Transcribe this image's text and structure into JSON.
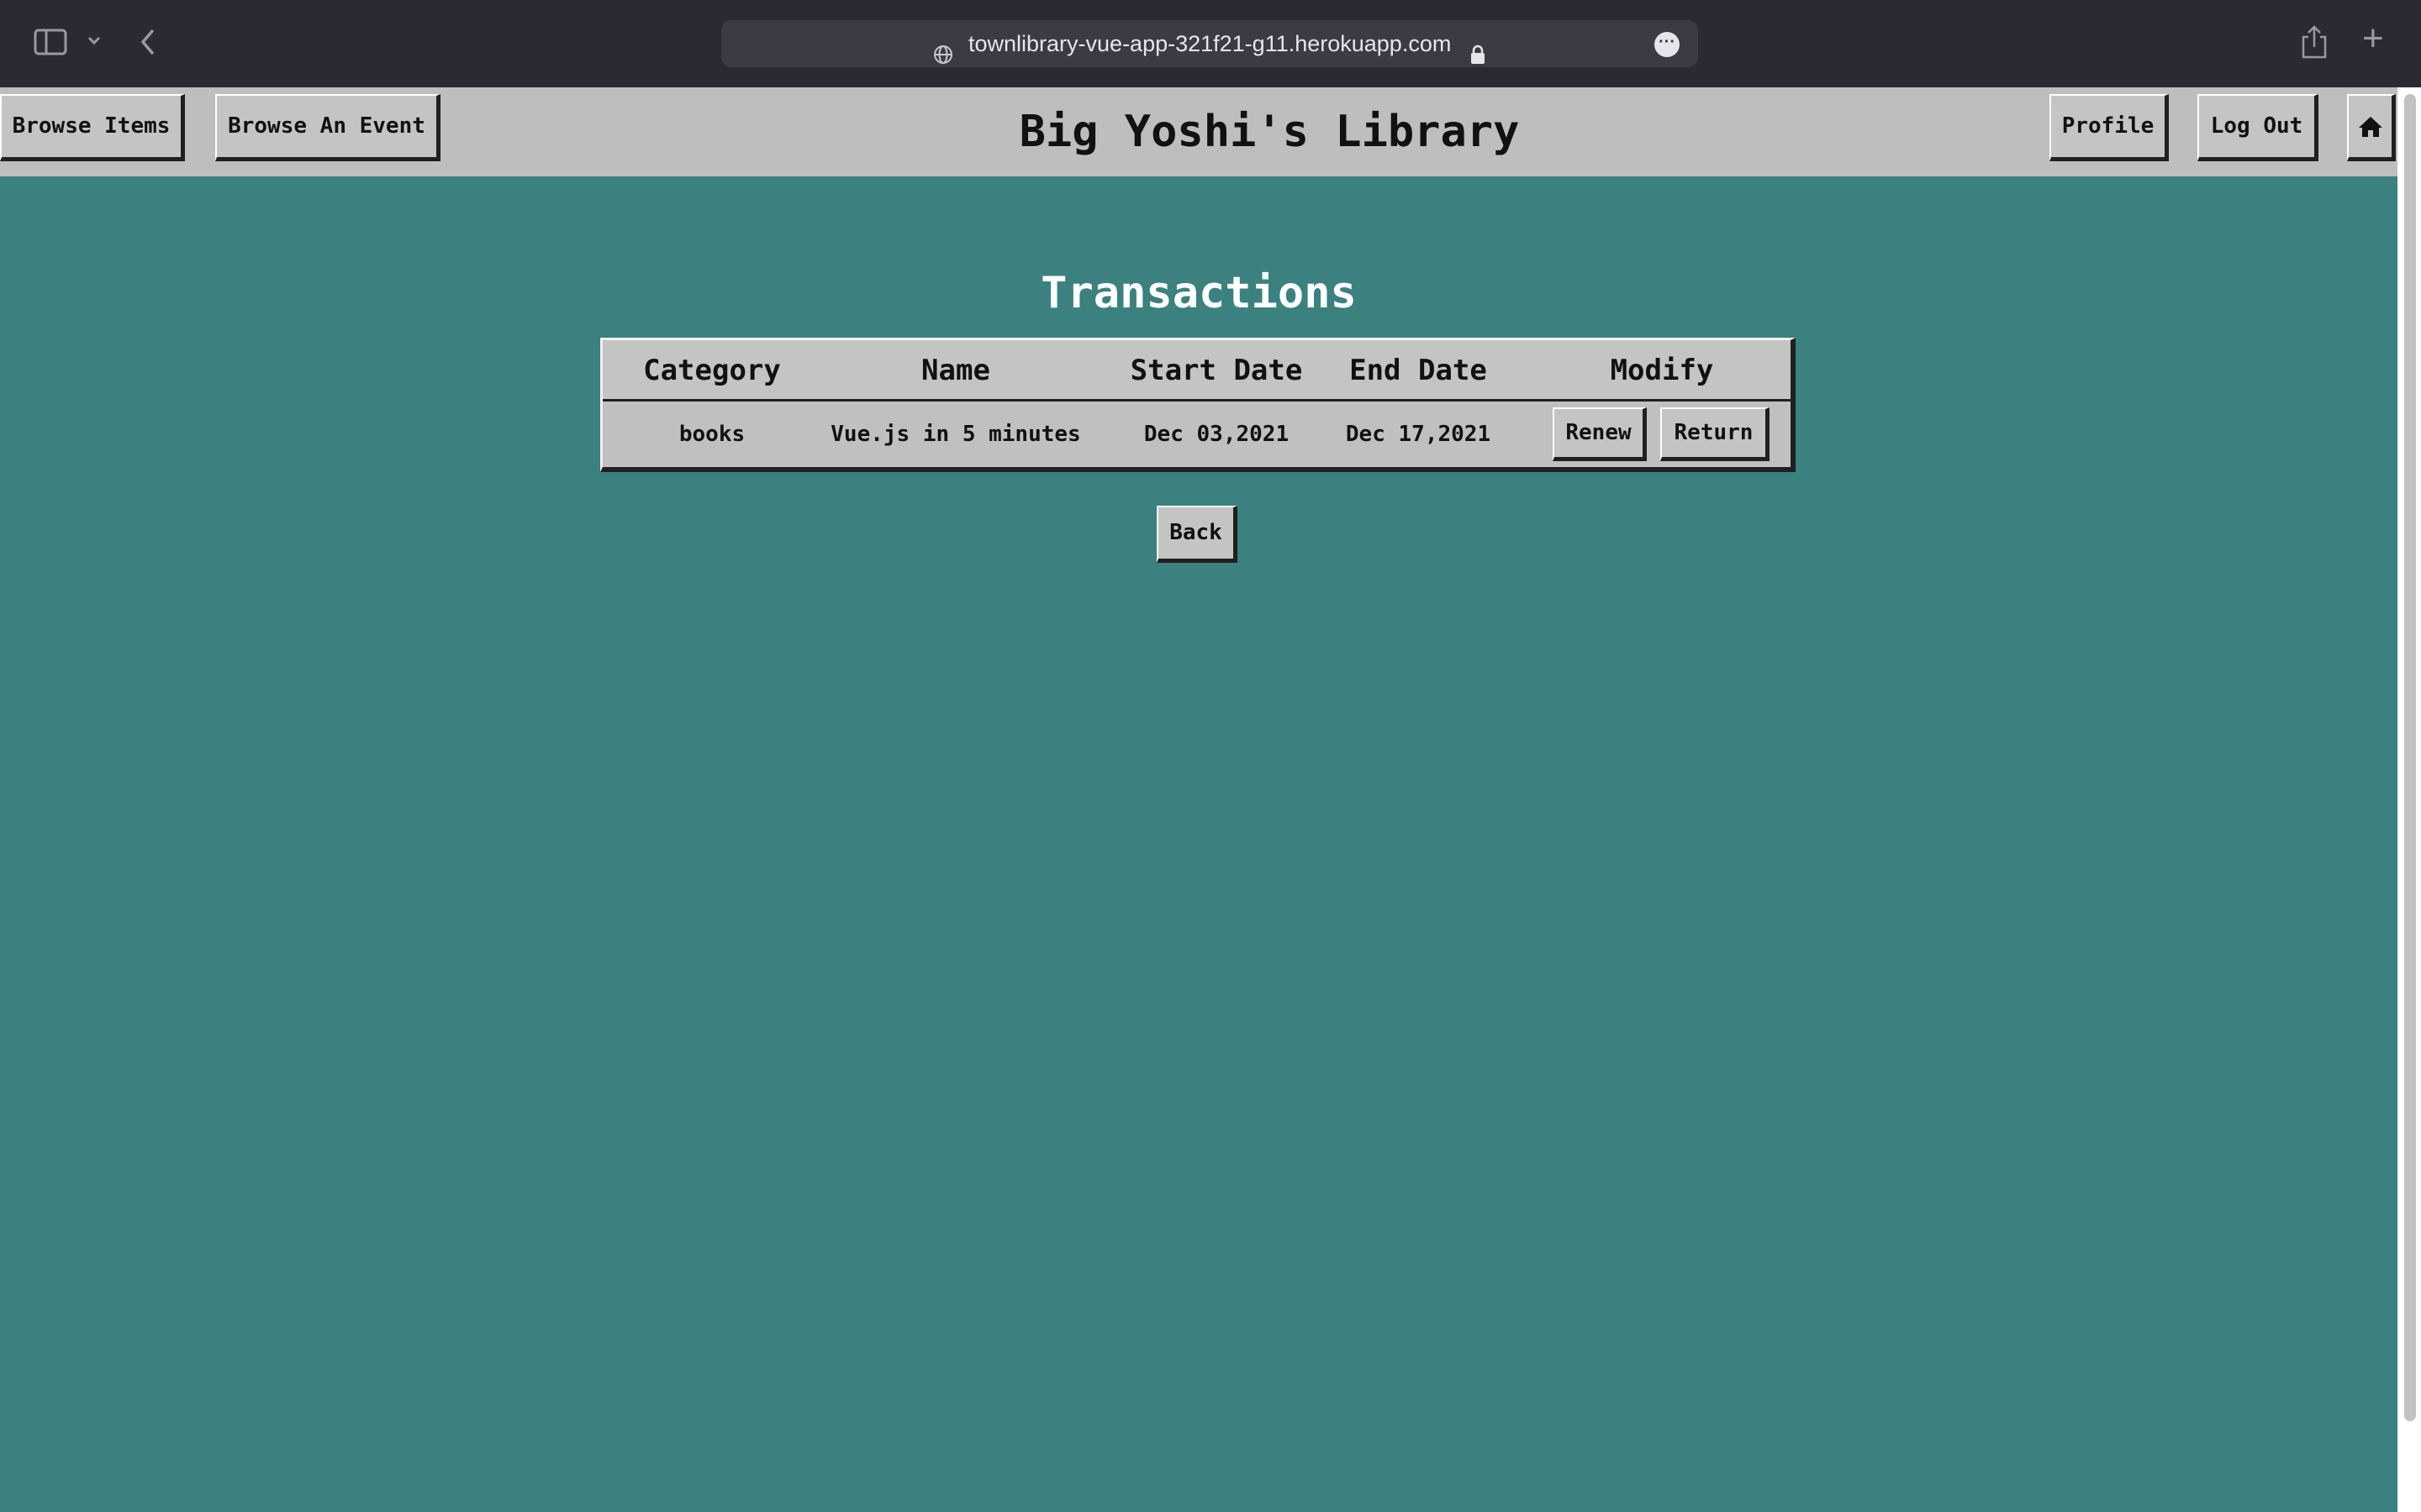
{
  "browser": {
    "url": "townlibrary-vue-app-321f21-g11.herokuapp.com",
    "icons": [
      "sidebar-icon",
      "chevron-down-icon",
      "back-arrow-icon",
      "globe-icon",
      "lock-icon",
      "more-icon",
      "share-icon",
      "new-tab-icon"
    ]
  },
  "header": {
    "browse_items": "Browse Items",
    "browse_event": "Browse An Event",
    "title": "Big Yoshi's Library",
    "profile": "Profile",
    "logout": "Log Out",
    "home_icon": "home-icon"
  },
  "main": {
    "heading": "Transactions",
    "table": {
      "columns": [
        "Category",
        "Name",
        "Start Date",
        "End Date",
        "Modify"
      ],
      "rows": [
        {
          "category": "books",
          "name": "Vue.js in 5 minutes",
          "start_date": "Dec 03,2021",
          "end_date": "Dec 17,2021",
          "renew": "Renew",
          "return": "Return"
        }
      ]
    },
    "back": "Back"
  },
  "colors": {
    "page_bg": "#3a8180",
    "header_bg": "#bebebe",
    "chrome_bg": "#2b2a33"
  }
}
